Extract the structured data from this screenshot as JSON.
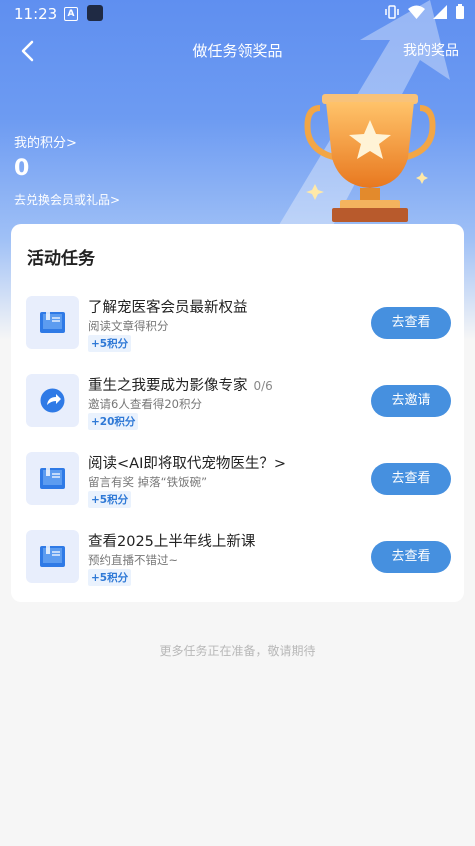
{
  "status_bar": {
    "time": "11:23",
    "a_icon": "A"
  },
  "nav": {
    "title": "做任务领奖品",
    "my_prizes": "我的奖品"
  },
  "points": {
    "label": "我的积分>",
    "value": "0",
    "redeem_link": "去兑换会员或礼品>"
  },
  "activity": {
    "title": "活动任务",
    "tasks": [
      {
        "icon": "book-icon",
        "title": "了解宠医客会员最新权益",
        "progress": "",
        "desc": "阅读文章得积分",
        "reward": "+5积分",
        "button": "去查看"
      },
      {
        "icon": "share-icon",
        "title": "重生之我要成为影像专家",
        "progress": "0/6",
        "desc": "邀请6人查看得20积分",
        "reward": "+20积分",
        "button": "去邀请"
      },
      {
        "icon": "book-icon",
        "title": "阅读<AI即将取代宠物医生？>",
        "progress": "",
        "desc": "留言有奖 掉落“铁饭碗”",
        "reward": "+5积分",
        "button": "去查看"
      },
      {
        "icon": "book-icon",
        "title": "查看2025上半年线上新课",
        "progress": "",
        "desc": "预约直播不错过~",
        "reward": "+5积分",
        "button": "去查看"
      }
    ]
  },
  "footer_note": "更多任务正在准备，敬请期待",
  "colors": {
    "primary": "#4690df",
    "hero": "#5f8ff0"
  }
}
